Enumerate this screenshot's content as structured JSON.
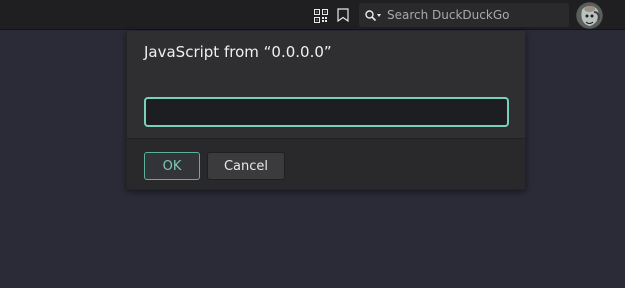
{
  "browser": {
    "toolbar": {
      "qr_icon_name": "qr-code-icon",
      "bookmark_icon_name": "bookmark-icon",
      "search": {
        "placeholder": "Search DuckDuckGo",
        "icon_name": "search-icon"
      },
      "avatar_icon_name": "avatar"
    }
  },
  "dialog": {
    "title": "JavaScript from “0.0.0.0”",
    "input_value": "",
    "ok_label": "OK",
    "cancel_label": "Cancel"
  },
  "colors": {
    "page_background": "#2a2b37",
    "toolbar_background": "#1f1f21",
    "dialog_background": "#2f2f31",
    "dialog_footer": "#29292b",
    "accent": "#79d1b8"
  }
}
